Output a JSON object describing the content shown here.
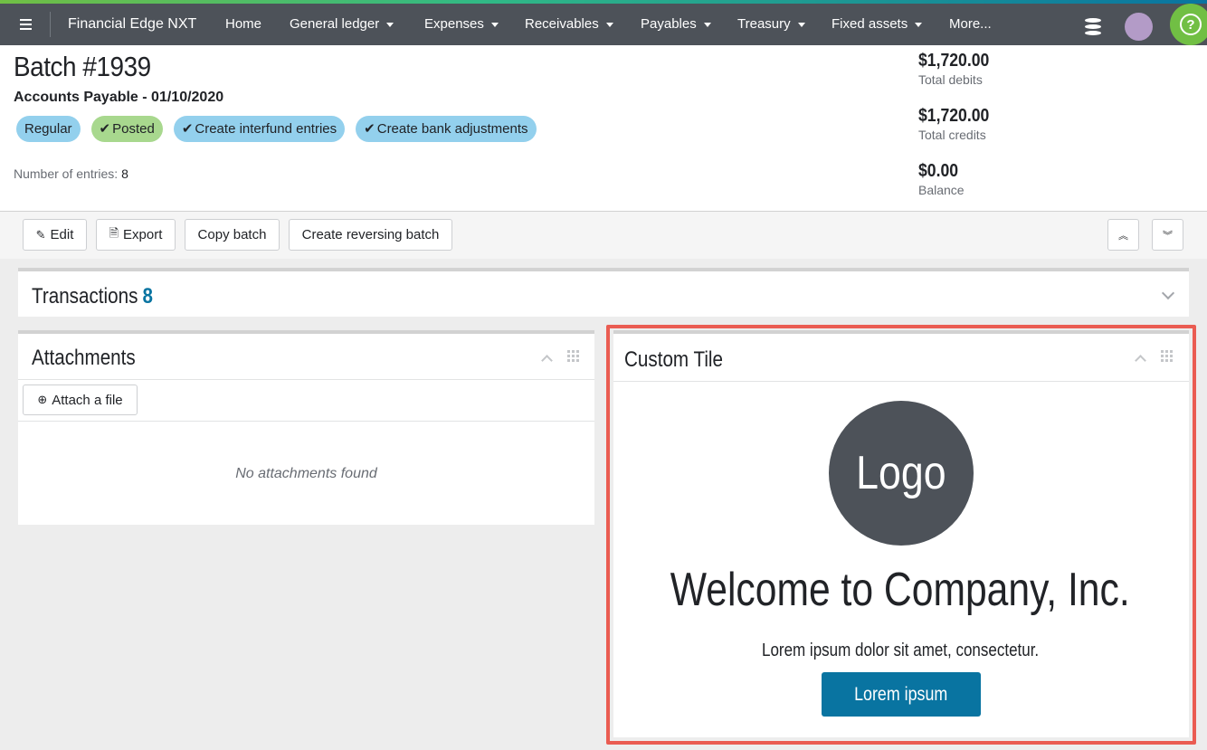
{
  "topbar": {
    "app_name": "Financial Edge NXT",
    "nav": [
      {
        "label": "Home"
      },
      {
        "label": "General ledger"
      },
      {
        "label": "Expenses"
      },
      {
        "label": "Receivables"
      },
      {
        "label": "Payables"
      },
      {
        "label": "Treasury"
      },
      {
        "label": "Fixed assets"
      },
      {
        "label": "More..."
      }
    ],
    "help_label": "?"
  },
  "record": {
    "title": "Batch #1939",
    "subtitle": "Accounts Payable - 01/10/2020",
    "tags": [
      {
        "label": "Regular",
        "check": ""
      },
      {
        "label": "Posted",
        "check": "✔"
      },
      {
        "label": "Create interfund entries",
        "check": "✔"
      },
      {
        "label": "Create bank adjustments",
        "check": "✔"
      }
    ],
    "entries_label": "Number of entries:",
    "entries_value": "8",
    "summary": [
      {
        "amount": "$1,720.00",
        "label": "Total debits"
      },
      {
        "amount": "$1,720.00",
        "label": "Total credits"
      },
      {
        "amount": "$0.00",
        "label": "Balance"
      }
    ]
  },
  "actions": {
    "edit": "Edit",
    "export": "Export",
    "copy": "Copy batch",
    "reverse": "Create reversing batch"
  },
  "transactions": {
    "title": "Transactions",
    "count": "8"
  },
  "attachments": {
    "title": "Attachments",
    "attach_label": "Attach a file",
    "empty": "No attachments found"
  },
  "custom_tile": {
    "title": "Custom Tile",
    "logo": "Logo",
    "welcome": "Welcome to Company, Inc.",
    "text": "Lorem ipsum dolor sit amet, consectetur.",
    "button": "Lorem ipsum"
  },
  "colors": {
    "nav_bg": "#4d5259",
    "accent_blue": "#0974a1",
    "tag_blue": "#93d0ed",
    "tag_green": "#a8d88e",
    "highlight": "#ea5c52"
  }
}
